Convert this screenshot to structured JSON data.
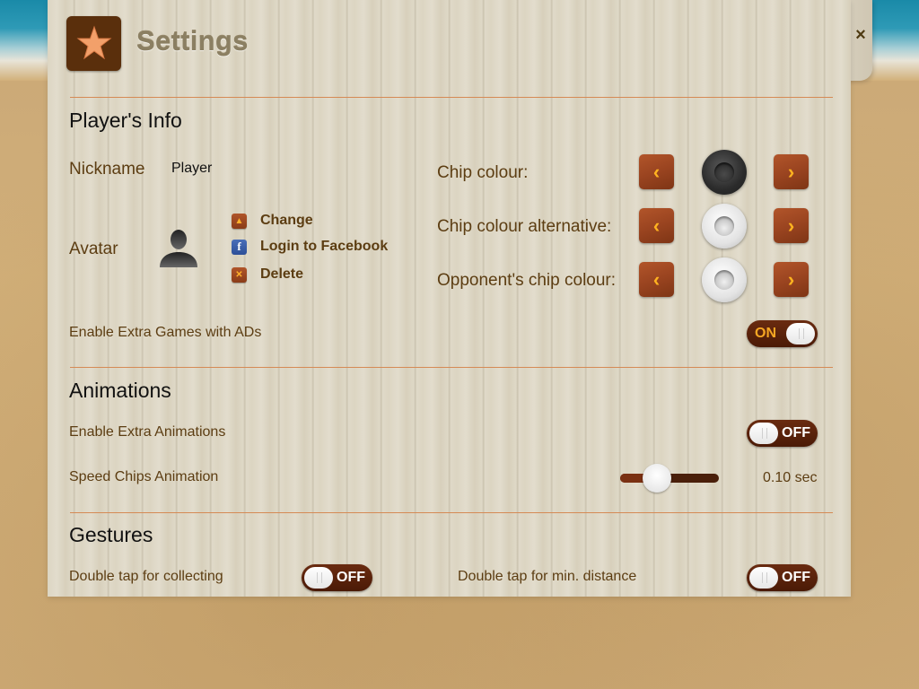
{
  "header": {
    "title": "Settings",
    "logo_icon": "starfish-icon",
    "close_icon": "close-icon",
    "close_label": "×"
  },
  "players_info": {
    "section_title": "Player's Info",
    "nickname_label": "Nickname",
    "nickname_value": "Player",
    "avatar_label": "Avatar",
    "avatar_actions": [
      {
        "icon": "upload-icon",
        "glyph": "▲",
        "label": "Change"
      },
      {
        "icon": "facebook-icon",
        "glyph": "f",
        "label": "Login to Facebook"
      },
      {
        "icon": "delete-icon",
        "glyph": "✕",
        "label": "Delete"
      }
    ],
    "chip_rows": [
      {
        "label": "Chip colour:",
        "chip": "dark",
        "prev": "‹",
        "next": "›"
      },
      {
        "label": "Chip colour alternative:",
        "chip": "light",
        "prev": "‹",
        "next": "›"
      },
      {
        "label": "Opponent's chip colour:",
        "chip": "light",
        "prev": "‹",
        "next": "›"
      }
    ],
    "extra_games_label": "Enable Extra Games with ADs",
    "extra_games_toggle": "ON"
  },
  "animations": {
    "section_title": "Animations",
    "extra_animations_label": "Enable Extra Animations",
    "extra_animations_toggle": "OFF",
    "speed_label": "Speed Chips Animation",
    "speed_value": "0.10 sec",
    "speed_slider_fraction": 0.37
  },
  "gestures": {
    "section_title": "Gestures",
    "collecting_label": "Double tap for collecting",
    "collecting_toggle": "OFF",
    "min_distance_label": "Double tap for min. distance",
    "min_distance_toggle": "OFF"
  },
  "colors": {
    "accent_orange": "#f5a623",
    "wood_brown": "#9a4420",
    "divider": "#d58a55",
    "label_brown": "#5c3d12"
  }
}
